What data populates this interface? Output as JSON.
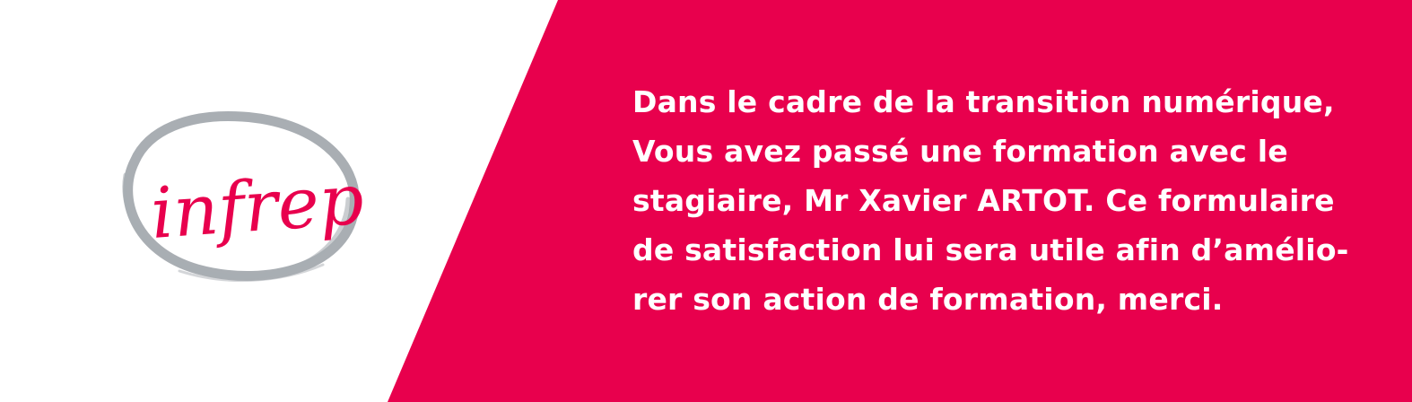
{
  "brand": {
    "name": "infrep",
    "accent_color": "#E8004D",
    "ring_color": "#A9AEB3"
  },
  "message": {
    "lines": [
      "Dans le cadre de la transition numérique,",
      "Vous avez passé une formation avec le",
      "stagiaire, Mr Xavier ARTOT. Ce formulaire",
      "de satisfaction lui sera utile afin d’amélio-",
      "rer son action de formation, merci."
    ]
  }
}
